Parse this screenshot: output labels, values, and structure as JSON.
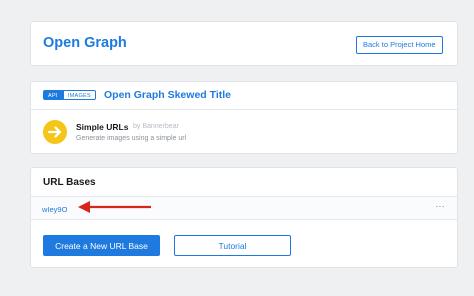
{
  "header": {
    "title": "Open Graph",
    "back_label": "Back to Project Home"
  },
  "template": {
    "tags": [
      "API",
      "IMAGES"
    ],
    "title": "Open Graph Skewed Title",
    "integration": {
      "name": "Simple URLs",
      "by": "by Bannerbear",
      "description": "Generate images using a simple url",
      "icon": "arrow-right-icon"
    }
  },
  "url_bases": {
    "title": "URL Bases",
    "items": [
      {
        "label": "wIey9O",
        "menu": "···"
      }
    ],
    "create_label": "Create a New URL Base",
    "tutorial_label": "Tutorial"
  },
  "colors": {
    "accent": "#1f7ae0",
    "integration_icon_bg": "#f5c518",
    "annotation_arrow": "#d9241b"
  }
}
